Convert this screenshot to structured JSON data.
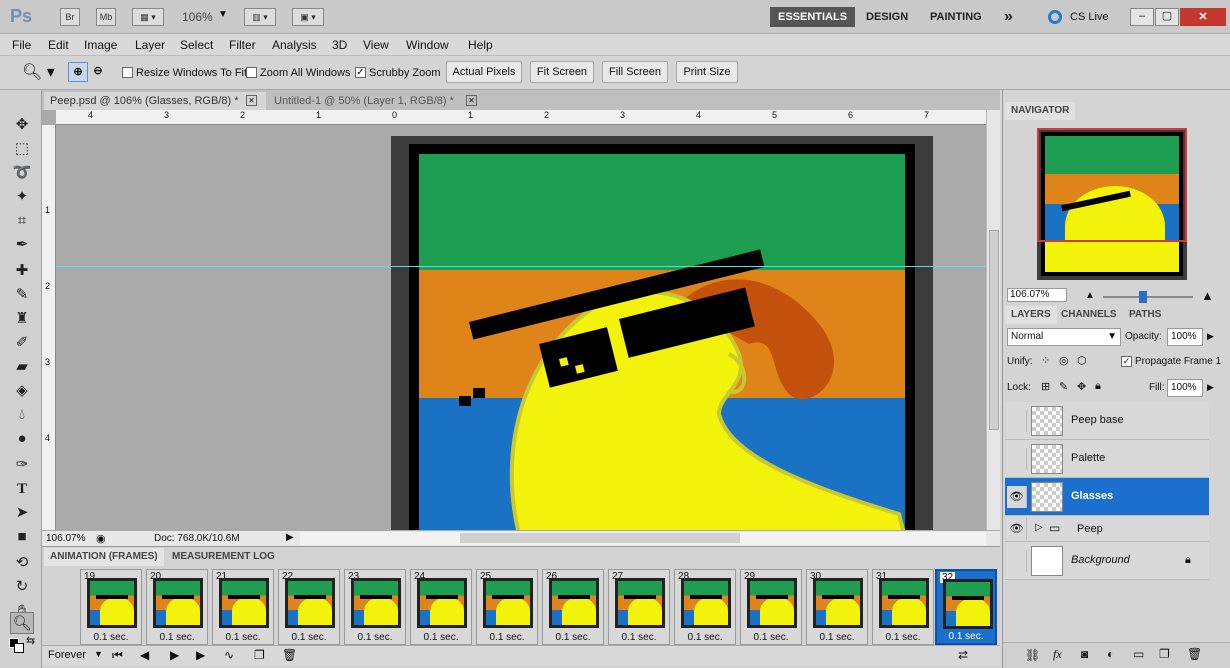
{
  "app": {
    "logo": "Ps",
    "zoom": "106%"
  },
  "titlebar": {
    "bridge": "Br",
    "minibridge": "Mb",
    "workspaces": [
      "ESSENTIALS",
      "DESIGN",
      "PAINTING"
    ],
    "more": "»",
    "cs_live": "CS Live"
  },
  "menu": [
    "File",
    "Edit",
    "Image",
    "Layer",
    "Select",
    "Filter",
    "Analysis",
    "3D",
    "View",
    "Window",
    "Help"
  ],
  "options": {
    "resize": "Resize Windows To Fit",
    "zoom_all": "Zoom All Windows",
    "scrubby": "Scrubby Zoom",
    "buttons": [
      "Actual Pixels",
      "Fit Screen",
      "Fill Screen",
      "Print Size"
    ]
  },
  "tabs": [
    "Peep.psd @ 106% (Glasses, RGB/8) *",
    "Untitled-1 @ 50% (Layer 1, RGB/8) *"
  ],
  "rulers": {
    "h": [
      "4",
      "3",
      "2",
      "1",
      "0",
      "1",
      "2",
      "3",
      "4",
      "5",
      "6",
      "7"
    ],
    "v": [
      "1",
      "2",
      "3",
      "4"
    ]
  },
  "status": {
    "zoom": "106.07%",
    "doc": "Doc: 768.0K/10.6M"
  },
  "animation": {
    "tabs": [
      "ANIMATION (FRAMES)",
      "MEASUREMENT LOG"
    ],
    "frames": [
      "19",
      "20",
      "21",
      "22",
      "23",
      "24",
      "25",
      "26",
      "27",
      "28",
      "29",
      "30",
      "31",
      "32"
    ],
    "delay": "0.1 sec.",
    "loop": "Forever"
  },
  "navigator": {
    "title": "NAVIGATOR",
    "zoom": "106.07%"
  },
  "layers": {
    "tabs": [
      "LAYERS",
      "CHANNELS",
      "PATHS"
    ],
    "blend": "Normal",
    "opacity_label": "Opacity:",
    "opacity": "100%",
    "unify": "Unify:",
    "propagate": "Propagate Frame 1",
    "lock": "Lock:",
    "fill_label": "Fill:",
    "fill": "100%",
    "rows": [
      "Peep base",
      "Palette",
      "Glasses",
      "Peep",
      "Background"
    ]
  },
  "colors": {
    "green": "#1e9e50",
    "orange": "#de8418",
    "blue": "#1a72c4",
    "yellow": "#f2f20a",
    "selected": "#1a6fcf"
  }
}
